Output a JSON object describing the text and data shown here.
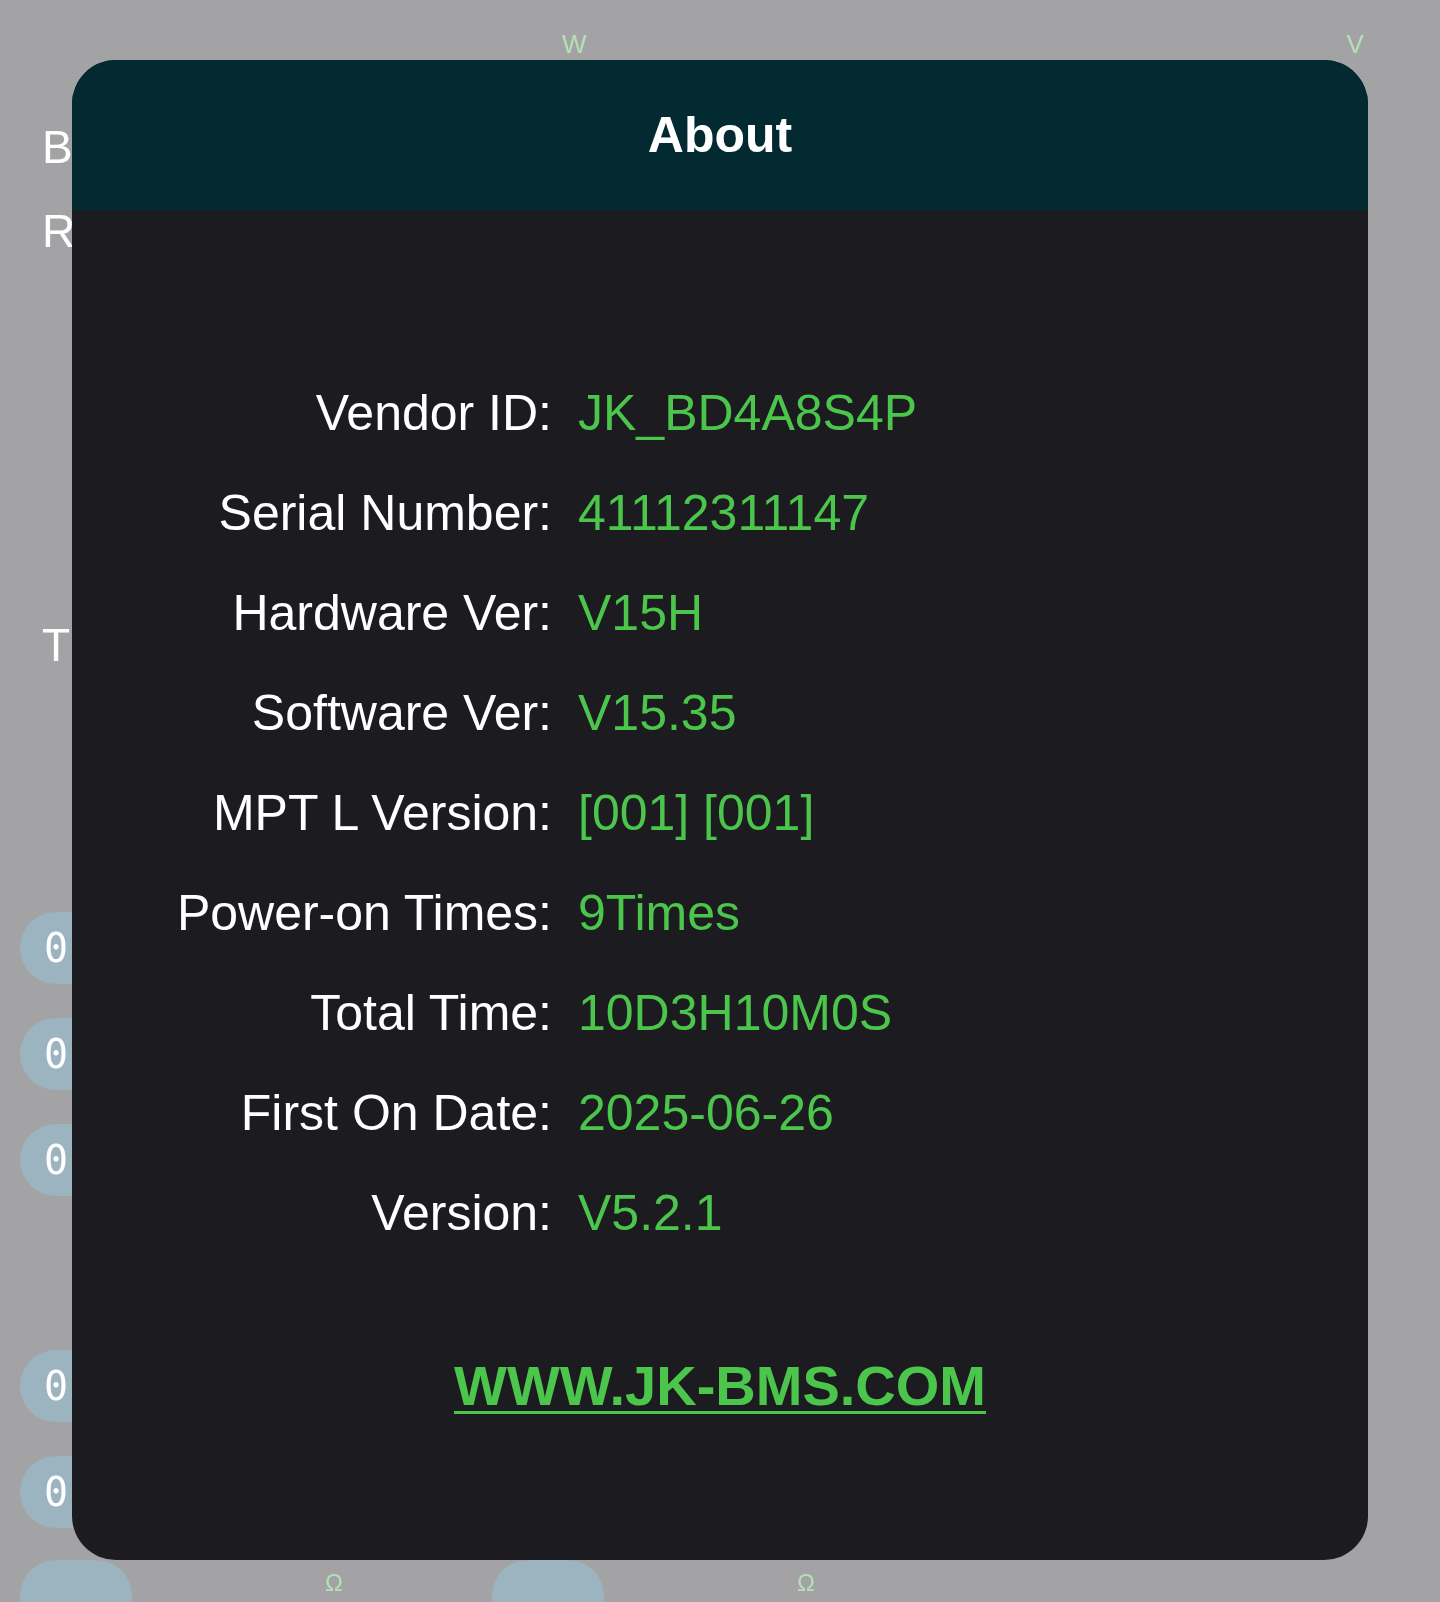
{
  "background": {
    "top_units": [
      "W",
      "V"
    ],
    "side_letters": [
      "B",
      "R",
      "T"
    ],
    "cell_pills": [
      "0",
      "0",
      "0",
      "0",
      "0"
    ],
    "resistances": [
      {
        "unit": "Ω"
      },
      {
        "unit": "Ω"
      }
    ]
  },
  "dialog": {
    "title": "About",
    "fields": [
      {
        "label": "Vendor ID:",
        "value": "JK_BD4A8S4P"
      },
      {
        "label": "Serial Number:",
        "value": "41112311147"
      },
      {
        "label": "Hardware Ver:",
        "value": "V15H"
      },
      {
        "label": "Software Ver:",
        "value": "V15.35"
      },
      {
        "label": "MPT L Version:",
        "value": "[001] [001]"
      },
      {
        "label": "Power-on Times:",
        "value": "9Times"
      },
      {
        "label": "Total Time:",
        "value": "10D3H10M0S"
      },
      {
        "label": "First On Date:",
        "value": "2025-06-26"
      },
      {
        "label": "Version:",
        "value": "V5.2.1"
      }
    ],
    "link": "WWW.JK-BMS.COM"
  }
}
